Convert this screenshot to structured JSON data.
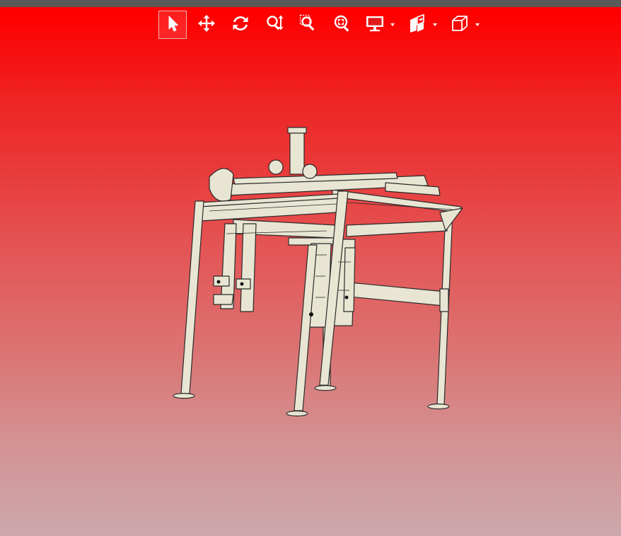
{
  "toolbar": {
    "tools": [
      {
        "id": "select",
        "icon": "pointer-arrow-icon",
        "active": true
      },
      {
        "id": "pan",
        "icon": "move-arrows-icon",
        "active": false
      },
      {
        "id": "rotate",
        "icon": "rotate-icon",
        "active": false
      },
      {
        "id": "zoom",
        "icon": "zoom-updown-icon",
        "active": false
      },
      {
        "id": "zoom-window",
        "icon": "zoom-window-icon",
        "active": false
      },
      {
        "id": "zoom-fit",
        "icon": "zoom-fit-icon",
        "active": false
      }
    ],
    "dropdowns": [
      {
        "id": "display-mode",
        "icon": "monitor-icon"
      },
      {
        "id": "section-view",
        "icon": "section-view-icon"
      },
      {
        "id": "view-orientation",
        "icon": "cube-icon"
      }
    ]
  },
  "viewport": {
    "background_top": "#ff0000",
    "background_bottom": "#cca8ad",
    "model_color": "#e8e6d3",
    "model_edge_color": "#2a2a2a"
  }
}
